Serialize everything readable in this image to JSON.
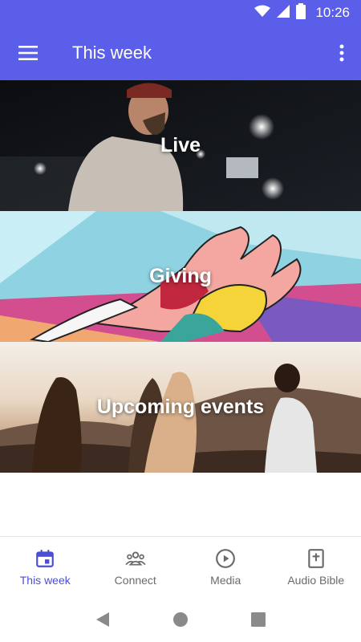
{
  "status_bar": {
    "time": "10:26",
    "icons": [
      "wifi-icon",
      "signal-icon",
      "battery-icon"
    ]
  },
  "app_bar": {
    "title": "This week",
    "menu_icon": "hamburger-menu-icon",
    "overflow_icon": "more-vert-icon"
  },
  "cards": [
    {
      "title": "Live",
      "image": "man-at-concert-photo"
    },
    {
      "title": "Giving",
      "image": "painted-hands-mural"
    },
    {
      "title": "Upcoming events",
      "image": "people-at-sunset-photo"
    }
  ],
  "bottom_nav": {
    "items": [
      {
        "label": "This week",
        "icon": "calendar-icon",
        "active": true
      },
      {
        "label": "Connect",
        "icon": "group-icon",
        "active": false
      },
      {
        "label": "Media",
        "icon": "play-circle-icon",
        "active": false
      },
      {
        "label": "Audio Bible",
        "icon": "bible-icon",
        "active": false
      }
    ]
  },
  "colors": {
    "primary": "#5a5ee8",
    "active_nav": "#4a4fd6",
    "inactive_nav": "#6b6b6b"
  }
}
